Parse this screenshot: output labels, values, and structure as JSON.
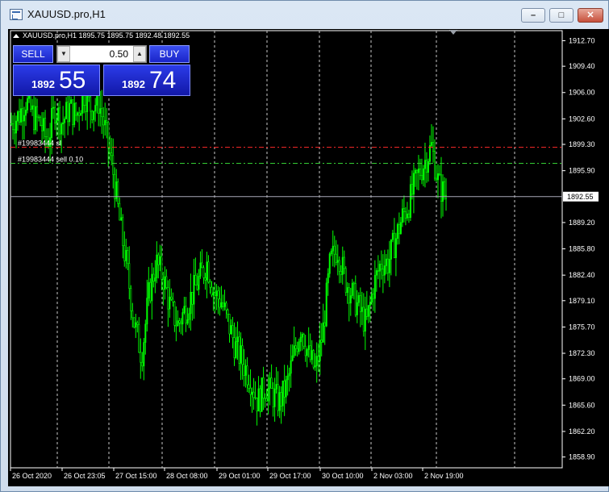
{
  "window": {
    "title": "XAUUSD.pro,H1"
  },
  "chart_header": {
    "info": "XAUUSD.pro,H1  1895.75 1895.75 1892.48 1892.55"
  },
  "trade_panel": {
    "sell_label": "SELL",
    "buy_label": "BUY",
    "lot": "0.50",
    "bid_big": "1892",
    "bid_small": "55",
    "ask_big": "1892",
    "ask_small": "74"
  },
  "order_lines": [
    {
      "label": "#19983444 sl",
      "price": 1898.92,
      "color": "#ff2a2a"
    },
    {
      "label": "#19983444 sell 0.10",
      "price": 1896.85,
      "color": "#33cc33"
    }
  ],
  "current_price": {
    "value": 1892.55,
    "label": "1892.55"
  },
  "chart_data": {
    "type": "candlestick",
    "symbol": "XAUUSD.pro",
    "timeframe": "H1",
    "y_ticks": [
      "1912.70",
      "1909.40",
      "1906.00",
      "1902.60",
      "1899.30",
      "1895.90",
      "1892.55",
      "1889.20",
      "1885.80",
      "1882.40",
      "1879.10",
      "1875.70",
      "1872.30",
      "1869.00",
      "1865.60",
      "1862.20",
      "1858.90"
    ],
    "y_tick_values": [
      1912.7,
      1909.4,
      1906.0,
      1902.6,
      1899.3,
      1895.9,
      1892.55,
      1889.2,
      1885.8,
      1882.4,
      1879.1,
      1875.7,
      1872.3,
      1869.0,
      1865.6,
      1862.2,
      1858.9
    ],
    "x_ticks": [
      "26 Oct 2020",
      "26 Oct 23:05",
      "27 Oct 15:00",
      "28 Oct 08:00",
      "29 Oct 01:00",
      "29 Oct 17:00",
      "30 Oct 10:00",
      "2 Nov 03:00",
      "2 Nov 19:00"
    ],
    "ylim": [
      1857.5,
      1914.0
    ],
    "series_color": "#00ff00",
    "close_path": [
      1902,
      1903,
      1905,
      1903,
      1902,
      1899.5,
      1904,
      1902,
      1904,
      1903,
      1906,
      1904,
      1905,
      1901,
      1896,
      1889,
      1883,
      1876,
      1872,
      1880,
      1884,
      1882,
      1878,
      1876,
      1878,
      1880,
      1882,
      1884,
      1880,
      1879,
      1876,
      1873,
      1871,
      1869,
      1866,
      1868,
      1867,
      1866,
      1868,
      1872,
      1876,
      1872,
      1870,
      1875,
      1884,
      1886,
      1882,
      1880,
      1878,
      1876,
      1881,
      1884,
      1884,
      1887,
      1890,
      1892,
      1895,
      1897,
      1899,
      1894,
      1892.55
    ]
  }
}
